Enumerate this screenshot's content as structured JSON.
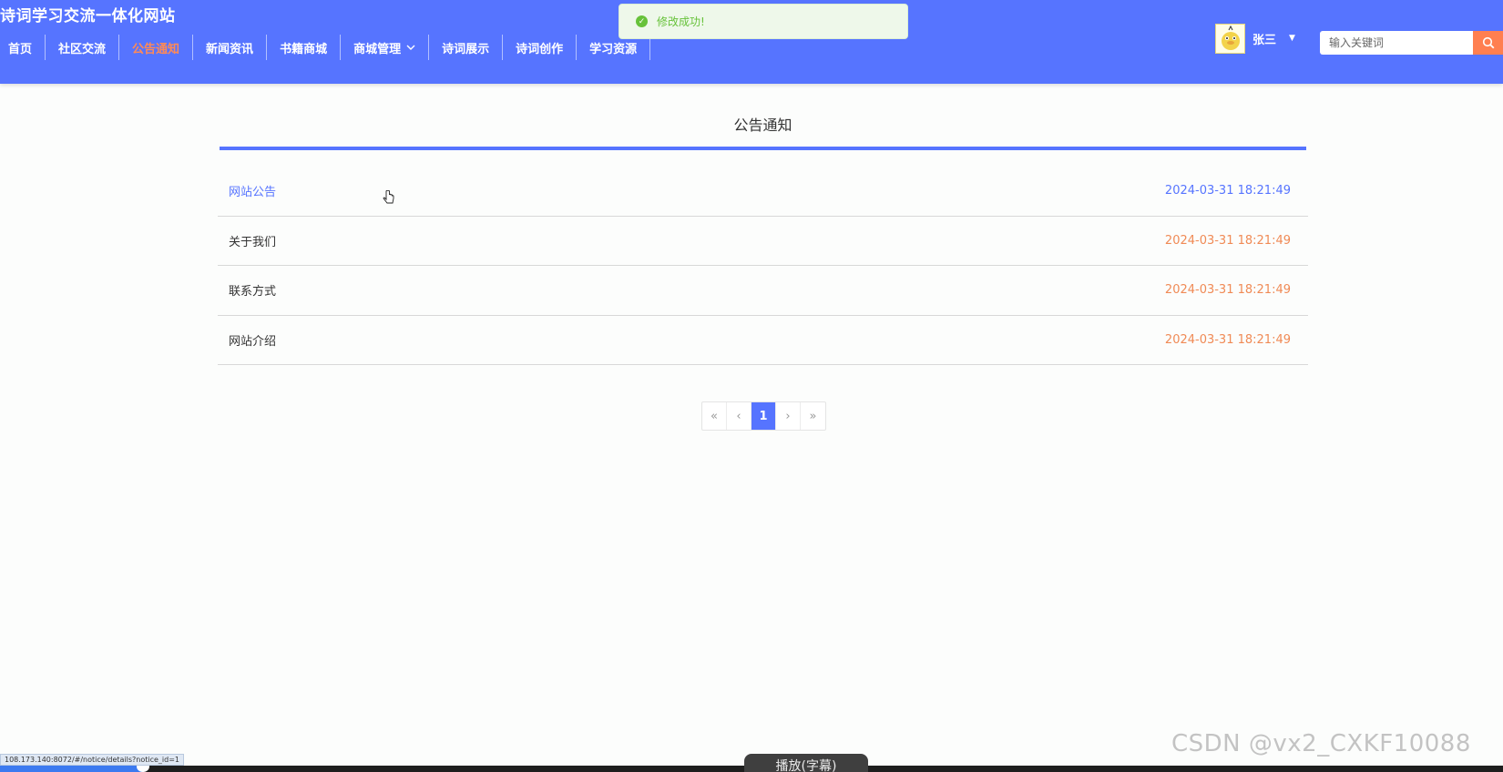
{
  "header": {
    "site_title": "诗词学习交流一体化网站",
    "nav": [
      {
        "label": "首页",
        "active": false
      },
      {
        "label": "社区交流",
        "active": false
      },
      {
        "label": "公告通知",
        "active": true
      },
      {
        "label": "新闻资讯",
        "active": false
      },
      {
        "label": "书籍商城",
        "active": false
      },
      {
        "label": "商城管理",
        "active": false,
        "dropdown": true
      },
      {
        "label": "诗词展示",
        "active": false
      },
      {
        "label": "诗词创作",
        "active": false
      },
      {
        "label": "学习资源",
        "active": false
      }
    ],
    "user": {
      "name": "张三",
      "avatar_icon": "duck-avatar-icon"
    },
    "search": {
      "placeholder": "输入关键词",
      "value": "",
      "button_icon": "search-icon"
    }
  },
  "toast": {
    "type": "success",
    "icon": "check-circle-icon",
    "message": "修改成功!"
  },
  "main": {
    "title": "公告通知",
    "notices": [
      {
        "title": "网站公告",
        "date": "2024-03-31 18:21:49",
        "hover": true
      },
      {
        "title": "关于我们",
        "date": "2024-03-31 18:21:49",
        "hover": false
      },
      {
        "title": "联系方式",
        "date": "2024-03-31 18:21:49",
        "hover": false
      },
      {
        "title": "网站介绍",
        "date": "2024-03-31 18:21:49",
        "hover": false
      }
    ],
    "pagination": {
      "first": "«",
      "prev": "‹",
      "current": "1",
      "next": "›",
      "last": "»"
    }
  },
  "overlay": {
    "status_url": "108.173.140:8072/#/notice/details?notice_id=1",
    "play_label": "播放(字幕)",
    "watermark": "CSDN @vx2_CXKF10088",
    "video_progress": 0.096
  },
  "colors": {
    "primary": "#5674ff",
    "accent": "#ff7f50",
    "date": "#f08a55",
    "success": "#67c23a"
  }
}
